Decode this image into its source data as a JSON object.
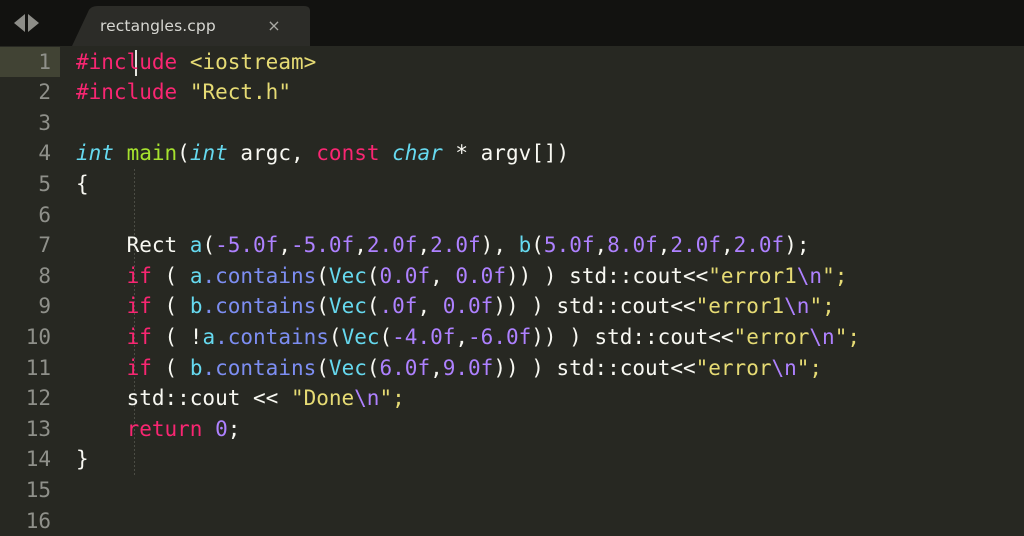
{
  "window": {
    "theme_background": "#272822",
    "tabbar_background": "#121210"
  },
  "tabbar": {
    "nav_prev_icon": "arrow-left-icon",
    "nav_next_icon": "arrow-right-icon",
    "tabs": [
      {
        "label": "rectangles.cpp",
        "close_label": "×",
        "active": true
      }
    ]
  },
  "editor": {
    "language": "cpp",
    "active_line": 1,
    "cursor": {
      "line": 1,
      "column": 1
    },
    "line_numbers": [
      "1",
      "2",
      "3",
      "4",
      "5",
      "6",
      "7",
      "8",
      "9",
      "10",
      "11",
      "12",
      "13",
      "14",
      "15",
      "16"
    ],
    "lines": [
      {
        "number": "1",
        "text": "#include <iostream>",
        "tokens": [
          {
            "text": "#include",
            "kind": "preprocessor"
          },
          {
            "text": " ",
            "kind": "plain"
          },
          {
            "text": "<iostream>",
            "kind": "string"
          }
        ]
      },
      {
        "number": "2",
        "text": "#include \"Rect.h\"",
        "tokens": [
          {
            "text": "#include",
            "kind": "preprocessor"
          },
          {
            "text": " ",
            "kind": "plain"
          },
          {
            "text": "\"Rect.h\"",
            "kind": "string"
          }
        ]
      },
      {
        "number": "3",
        "text": "",
        "tokens": []
      },
      {
        "number": "4",
        "text": "int main(int argc, const char * argv[])",
        "tokens": [
          {
            "text": "int",
            "kind": "type"
          },
          {
            "text": " ",
            "kind": "plain"
          },
          {
            "text": "main",
            "kind": "function"
          },
          {
            "text": "(",
            "kind": "plain"
          },
          {
            "text": "int",
            "kind": "type"
          },
          {
            "text": " argc, ",
            "kind": "plain"
          },
          {
            "text": "const",
            "kind": "keyword"
          },
          {
            "text": " ",
            "kind": "plain"
          },
          {
            "text": "char",
            "kind": "type"
          },
          {
            "text": " * argv[])",
            "kind": "plain"
          }
        ]
      },
      {
        "number": "5",
        "text": "{",
        "tokens": [
          {
            "text": "{",
            "kind": "plain"
          }
        ]
      },
      {
        "number": "6",
        "text": "",
        "tokens": []
      },
      {
        "number": "7",
        "text": "    Rect a(-5.0f,-5.0f,2.0f,2.0f), b(5.0f,8.0f,2.0f,2.0f);",
        "tokens": [
          {
            "text": "    Rect ",
            "kind": "plain"
          },
          {
            "text": "a",
            "kind": "variable"
          },
          {
            "text": "(",
            "kind": "plain"
          },
          {
            "text": "-5.0f",
            "kind": "number"
          },
          {
            "text": ",",
            "kind": "plain"
          },
          {
            "text": "-5.0f",
            "kind": "number"
          },
          {
            "text": ",",
            "kind": "plain"
          },
          {
            "text": "2.0f",
            "kind": "number"
          },
          {
            "text": ",",
            "kind": "plain"
          },
          {
            "text": "2.0f",
            "kind": "number"
          },
          {
            "text": "), ",
            "kind": "plain"
          },
          {
            "text": "b",
            "kind": "variable"
          },
          {
            "text": "(",
            "kind": "plain"
          },
          {
            "text": "5.0f",
            "kind": "number"
          },
          {
            "text": ",",
            "kind": "plain"
          },
          {
            "text": "8.0f",
            "kind": "number"
          },
          {
            "text": ",",
            "kind": "plain"
          },
          {
            "text": "2.0f",
            "kind": "number"
          },
          {
            "text": ",",
            "kind": "plain"
          },
          {
            "text": "2.0f",
            "kind": "number"
          },
          {
            "text": ");",
            "kind": "plain"
          }
        ]
      },
      {
        "number": "8",
        "text": "    if ( a.contains(Vec(0.0f, 0.0f)) ) std::cout<<\"error1\\n\";",
        "tokens": [
          {
            "text": "    ",
            "kind": "plain"
          },
          {
            "text": "if",
            "kind": "keyword"
          },
          {
            "text": " ( ",
            "kind": "plain"
          },
          {
            "text": "a",
            "kind": "variable"
          },
          {
            "text": ".contains",
            "kind": "member"
          },
          {
            "text": "(",
            "kind": "plain"
          },
          {
            "text": "Vec",
            "kind": "variable"
          },
          {
            "text": "(",
            "kind": "plain"
          },
          {
            "text": "0.0f",
            "kind": "number"
          },
          {
            "text": ", ",
            "kind": "plain"
          },
          {
            "text": "0.0f",
            "kind": "number"
          },
          {
            "text": ")) ) std::cout<<",
            "kind": "plain"
          },
          {
            "text": "\"error1",
            "kind": "string"
          },
          {
            "text": "\\n",
            "kind": "escape"
          },
          {
            "text": "\";",
            "kind": "string"
          }
        ]
      },
      {
        "number": "9",
        "text": "    if ( b.contains(Vec(.0f, 0.0f)) ) std::cout<<\"error1\\n\";",
        "tokens": [
          {
            "text": "    ",
            "kind": "plain"
          },
          {
            "text": "if",
            "kind": "keyword"
          },
          {
            "text": " ( ",
            "kind": "plain"
          },
          {
            "text": "b",
            "kind": "variable"
          },
          {
            "text": ".contains",
            "kind": "member"
          },
          {
            "text": "(",
            "kind": "plain"
          },
          {
            "text": "Vec",
            "kind": "variable"
          },
          {
            "text": "(",
            "kind": "plain"
          },
          {
            "text": ".0f",
            "kind": "number"
          },
          {
            "text": ", ",
            "kind": "plain"
          },
          {
            "text": "0.0f",
            "kind": "number"
          },
          {
            "text": ")) ) std::cout<<",
            "kind": "plain"
          },
          {
            "text": "\"error1",
            "kind": "string"
          },
          {
            "text": "\\n",
            "kind": "escape"
          },
          {
            "text": "\";",
            "kind": "string"
          }
        ]
      },
      {
        "number": "10",
        "text": "    if ( !a.contains(Vec(-4.0f,-6.0f)) ) std::cout<<\"error\\n\";",
        "tokens": [
          {
            "text": "    ",
            "kind": "plain"
          },
          {
            "text": "if",
            "kind": "keyword"
          },
          {
            "text": " ( !",
            "kind": "plain"
          },
          {
            "text": "a",
            "kind": "variable"
          },
          {
            "text": ".contains",
            "kind": "member"
          },
          {
            "text": "(",
            "kind": "plain"
          },
          {
            "text": "Vec",
            "kind": "variable"
          },
          {
            "text": "(",
            "kind": "plain"
          },
          {
            "text": "-4.0f",
            "kind": "number"
          },
          {
            "text": ",",
            "kind": "plain"
          },
          {
            "text": "-6.0f",
            "kind": "number"
          },
          {
            "text": ")) ) std::cout<<",
            "kind": "plain"
          },
          {
            "text": "\"error",
            "kind": "string"
          },
          {
            "text": "\\n",
            "kind": "escape"
          },
          {
            "text": "\";",
            "kind": "string"
          }
        ]
      },
      {
        "number": "11",
        "text": "    if ( b.contains(Vec(6.0f,9.0f)) ) std::cout<<\"error\\n\";",
        "tokens": [
          {
            "text": "    ",
            "kind": "plain"
          },
          {
            "text": "if",
            "kind": "keyword"
          },
          {
            "text": " ( ",
            "kind": "plain"
          },
          {
            "text": "b",
            "kind": "variable"
          },
          {
            "text": ".contains",
            "kind": "member"
          },
          {
            "text": "(",
            "kind": "plain"
          },
          {
            "text": "Vec",
            "kind": "variable"
          },
          {
            "text": "(",
            "kind": "plain"
          },
          {
            "text": "6.0f",
            "kind": "number"
          },
          {
            "text": ",",
            "kind": "plain"
          },
          {
            "text": "9.0f",
            "kind": "number"
          },
          {
            "text": ")) ) std::cout<<",
            "kind": "plain"
          },
          {
            "text": "\"error",
            "kind": "string"
          },
          {
            "text": "\\n",
            "kind": "escape"
          },
          {
            "text": "\";",
            "kind": "string"
          }
        ]
      },
      {
        "number": "12",
        "text": "    std::cout << \"Done\\n\";",
        "tokens": [
          {
            "text": "    std::cout << ",
            "kind": "plain"
          },
          {
            "text": "\"Done",
            "kind": "string"
          },
          {
            "text": "\\n",
            "kind": "escape"
          },
          {
            "text": "\";",
            "kind": "string"
          }
        ]
      },
      {
        "number": "13",
        "text": "    return 0;",
        "tokens": [
          {
            "text": "    ",
            "kind": "plain"
          },
          {
            "text": "return",
            "kind": "keyword"
          },
          {
            "text": " ",
            "kind": "plain"
          },
          {
            "text": "0",
            "kind": "number"
          },
          {
            "text": ";",
            "kind": "plain"
          }
        ]
      },
      {
        "number": "14",
        "text": "}",
        "tokens": [
          {
            "text": "}",
            "kind": "plain"
          }
        ]
      },
      {
        "number": "15",
        "text": "",
        "tokens": []
      },
      {
        "number": "16",
        "text": "",
        "tokens": []
      }
    ]
  }
}
